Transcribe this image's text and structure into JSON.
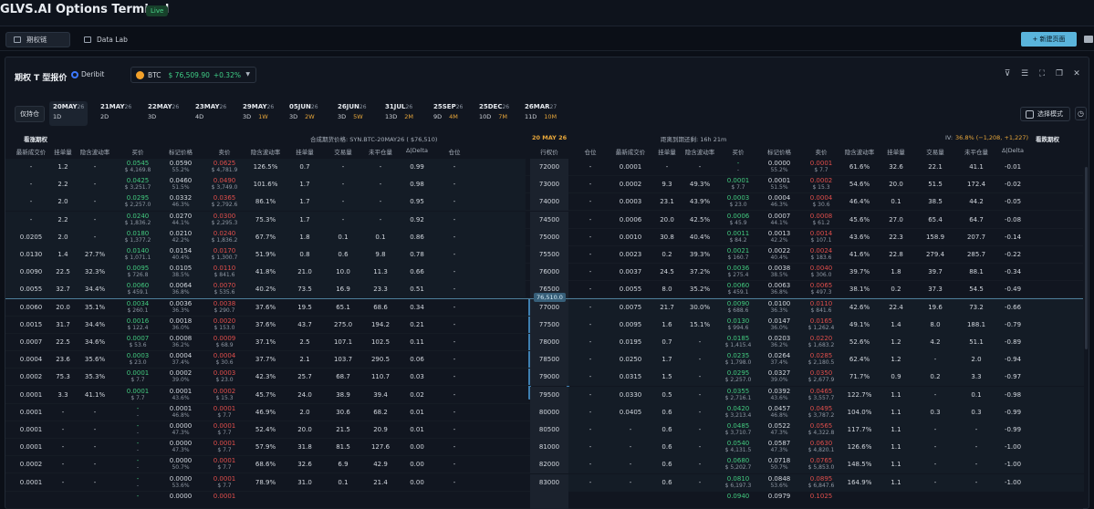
{
  "app": {
    "title": "GLVS.AI Options Terminal",
    "live": "Live"
  },
  "tabs": [
    {
      "label": "期权链"
    },
    {
      "label": "Data Lab"
    }
  ],
  "new_page": "+ 新建页面",
  "panel": {
    "title": "期权 T 型报价",
    "exchange": "Deribit",
    "asset": "BTC",
    "price": "$ 76,509.90",
    "change": "+0.32%"
  },
  "only_btn": "仅持仓",
  "expiries": [
    {
      "date": "20MAY",
      "yy": "26",
      "dte": "1D",
      "cal": ""
    },
    {
      "date": "21MAY",
      "yy": "26",
      "dte": "2D",
      "cal": ""
    },
    {
      "date": "22MAY",
      "yy": "26",
      "dte": "3D",
      "cal": ""
    },
    {
      "date": "23MAY",
      "yy": "26",
      "dte": "4D",
      "cal": ""
    },
    {
      "date": "29MAY",
      "yy": "26",
      "dte": "3D",
      "cal": "1W"
    },
    {
      "date": "05JUN",
      "yy": "26",
      "dte": "3D",
      "cal": "2W"
    },
    {
      "date": "26JUN",
      "yy": "26",
      "dte": "3D",
      "cal": "5W"
    },
    {
      "date": "31JUL",
      "yy": "26",
      "dte": "13D",
      "cal": "2M"
    },
    {
      "date": "25SEP",
      "yy": "26",
      "dte": "9D",
      "cal": "4M"
    },
    {
      "date": "25DEC",
      "yy": "26",
      "dte": "10D",
      "cal": "7M"
    },
    {
      "date": "26MAR",
      "yy": "27",
      "dte": "11D",
      "cal": "10M"
    }
  ],
  "mode_btn": "选择模式",
  "subhead": {
    "calls": "看涨期权",
    "synthetic": "合成期货价格: SYN.BTC-20MAY26 ( $76,510)",
    "expiry": "20 MAY 26",
    "countdown": "距离到期还剩: 16h 21m",
    "iv_label": "IV:",
    "iv": "36.8% (−1,208, +1,227)",
    "puts": "看跌期权"
  },
  "headers": {
    "call": [
      "最新成交价",
      "挂单量",
      "隐含波动率",
      "买价",
      "标记价格",
      "卖价",
      "隐含波动率",
      "挂单量",
      "交易量",
      "未平仓量",
      "Δ|Delta",
      "仓位"
    ],
    "strike": "行权价",
    "put": [
      "仓位",
      "最新成交价",
      "挂单量",
      "隐含波动率",
      "买价",
      "标记价格",
      "卖价",
      "隐含波动率",
      "挂单量",
      "交易量",
      "未平仓量",
      "Δ|Delta"
    ]
  },
  "atm": "76,510.0",
  "rows": [
    {
      "strike": "72000",
      "c": [
        "-",
        "1.2",
        "-",
        [
          "0.0545",
          "$ 4,169.8"
        ],
        [
          "0.0590",
          "55.2%"
        ],
        [
          "0.0625",
          "$ 4,781.9"
        ],
        "126.5%",
        "0.7",
        "-",
        "-",
        "0.99",
        "-"
      ],
      "p": [
        "-",
        "0.0001",
        "-",
        "-",
        [
          "-",
          "-"
        ],
        [
          "0.0000",
          "55.2%"
        ],
        [
          "0.0001",
          "$ 7.7"
        ],
        "61.6%",
        "32.6",
        "22.1",
        "41.1",
        "-0.01"
      ]
    },
    {
      "strike": "73000",
      "c": [
        "-",
        "2.2",
        "-",
        [
          "0.0425",
          "$ 3,251.7"
        ],
        [
          "0.0460",
          "51.5%"
        ],
        [
          "0.0490",
          "$ 3,749.0"
        ],
        "101.6%",
        "1.7",
        "-",
        "-",
        "0.98",
        "-"
      ],
      "p": [
        "-",
        "0.0002",
        "9.3",
        "49.3%",
        [
          "0.0001",
          "$ 7.7"
        ],
        [
          "0.0001",
          "51.5%"
        ],
        [
          "0.0002",
          "$ 15.3"
        ],
        "54.6%",
        "20.0",
        "51.5",
        "172.4",
        "-0.02"
      ]
    },
    {
      "strike": "74000",
      "c": [
        "-",
        "2.0",
        "-",
        [
          "0.0295",
          "$ 2,257.0"
        ],
        [
          "0.0332",
          "46.3%"
        ],
        [
          "0.0365",
          "$ 2,792.6"
        ],
        "86.1%",
        "1.7",
        "-",
        "-",
        "0.95",
        "-"
      ],
      "p": [
        "-",
        "0.0003",
        "23.1",
        "43.9%",
        [
          "0.0003",
          "$ 23.0"
        ],
        [
          "0.0004",
          "46.3%"
        ],
        [
          "0.0004",
          "$ 30.6"
        ],
        "46.4%",
        "0.1",
        "38.5",
        "44.2",
        "-0.05"
      ]
    },
    {
      "strike": "74500",
      "c": [
        "-",
        "2.2",
        "-",
        [
          "0.0240",
          "$ 1,836.2"
        ],
        [
          "0.0270",
          "44.1%"
        ],
        [
          "0.0300",
          "$ 2,295.3"
        ],
        "75.3%",
        "1.7",
        "-",
        "-",
        "0.92",
        "-"
      ],
      "p": [
        "-",
        "0.0006",
        "20.0",
        "42.5%",
        [
          "0.0006",
          "$ 45.9"
        ],
        [
          "0.0007",
          "44.1%"
        ],
        [
          "0.0008",
          "$ 61.2"
        ],
        "45.6%",
        "27.0",
        "65.4",
        "64.7",
        "-0.08"
      ]
    },
    {
      "strike": "75000",
      "c": [
        "0.0205",
        "2.0",
        "-",
        [
          "0.0180",
          "$ 1,377.2"
        ],
        [
          "0.0210",
          "42.2%"
        ],
        [
          "0.0240",
          "$ 1,836.2"
        ],
        "67.7%",
        "1.8",
        "0.1",
        "0.1",
        "0.86",
        "-"
      ],
      "p": [
        "-",
        "0.0010",
        "30.8",
        "40.4%",
        [
          "0.0011",
          "$ 84.2"
        ],
        [
          "0.0013",
          "42.2%"
        ],
        [
          "0.0014",
          "$ 107.1"
        ],
        "43.6%",
        "22.3",
        "158.9",
        "207.7",
        "-0.14"
      ]
    },
    {
      "strike": "75500",
      "c": [
        "0.0130",
        "1.4",
        "27.7%",
        [
          "0.0140",
          "$ 1,071.1"
        ],
        [
          "0.0154",
          "40.4%"
        ],
        [
          "0.0170",
          "$ 1,300.7"
        ],
        "51.9%",
        "0.8",
        "0.6",
        "9.8",
        "0.78",
        "-"
      ],
      "p": [
        "-",
        "0.0023",
        "0.2",
        "39.3%",
        [
          "0.0021",
          "$ 160.7"
        ],
        [
          "0.0022",
          "40.4%"
        ],
        [
          "0.0024",
          "$ 183.6"
        ],
        "41.6%",
        "22.8",
        "279.4",
        "285.7",
        "-0.22"
      ]
    },
    {
      "strike": "76000",
      "c": [
        "0.0090",
        "22.5",
        "32.3%",
        [
          "0.0095",
          "$ 726.8"
        ],
        [
          "0.0105",
          "38.5%"
        ],
        [
          "0.0110",
          "$ 841.6"
        ],
        "41.8%",
        "21.0",
        "10.0",
        "11.3",
        "0.66",
        "-"
      ],
      "p": [
        "-",
        "0.0037",
        "24.5",
        "37.2%",
        [
          "0.0036",
          "$ 275.4"
        ],
        [
          "0.0038",
          "38.5%"
        ],
        [
          "0.0040",
          "$ 306.0"
        ],
        "39.7%",
        "1.8",
        "39.7",
        "88.1",
        "-0.34"
      ]
    },
    {
      "strike": "76500",
      "c": [
        "0.0055",
        "32.7",
        "34.4%",
        [
          "0.0060",
          "$ 459.1"
        ],
        [
          "0.0064",
          "36.8%"
        ],
        [
          "0.0070",
          "$ 535.6"
        ],
        "40.2%",
        "73.5",
        "16.9",
        "23.3",
        "0.51",
        "-"
      ],
      "p": [
        "-",
        "0.0055",
        "8.0",
        "35.2%",
        [
          "0.0060",
          "$ 459.1"
        ],
        [
          "0.0063",
          "36.8%"
        ],
        [
          "0.0065",
          "$ 497.3"
        ],
        "38.1%",
        "0.2",
        "37.3",
        "54.5",
        "-0.49"
      ]
    },
    {
      "strike": "77000",
      "c": [
        "0.0060",
        "20.0",
        "35.1%",
        [
          "0.0034",
          "$ 260.1"
        ],
        [
          "0.0036",
          "36.3%"
        ],
        [
          "0.0038",
          "$ 290.7"
        ],
        "37.6%",
        "19.5",
        "65.1",
        "68.6",
        "0.34",
        "-"
      ],
      "p": [
        "-",
        "0.0075",
        "21.7",
        "30.0%",
        [
          "0.0090",
          "$ 688.6"
        ],
        [
          "0.0100",
          "36.3%"
        ],
        [
          "0.0110",
          "$ 841.6"
        ],
        "42.6%",
        "22.4",
        "19.6",
        "73.2",
        "-0.66"
      ]
    },
    {
      "strike": "77500",
      "c": [
        "0.0015",
        "31.7",
        "34.4%",
        [
          "0.0016",
          "$ 122.4"
        ],
        [
          "0.0018",
          "36.0%"
        ],
        [
          "0.0020",
          "$ 153.0"
        ],
        "37.6%",
        "43.7",
        "275.0",
        "194.2",
        "0.21",
        "-"
      ],
      "p": [
        "-",
        "0.0095",
        "1.6",
        "15.1%",
        [
          "0.0130",
          "$ 994.6"
        ],
        [
          "0.0147",
          "36.0%"
        ],
        [
          "0.0165",
          "$ 1,262.4"
        ],
        "49.1%",
        "1.4",
        "8.0",
        "188.1",
        "-0.79"
      ]
    },
    {
      "strike": "78000",
      "c": [
        "0.0007",
        "22.5",
        "34.6%",
        [
          "0.0007",
          "$ 53.6"
        ],
        [
          "0.0008",
          "36.2%"
        ],
        [
          "0.0009",
          "$ 68.9"
        ],
        "37.1%",
        "2.5",
        "107.1",
        "102.5",
        "0.11",
        "-"
      ],
      "p": [
        "-",
        "0.0195",
        "0.7",
        "-",
        [
          "0.0185",
          "$ 1,415.4"
        ],
        [
          "0.0203",
          "36.2%"
        ],
        [
          "0.0220",
          "$ 1,683.2"
        ],
        "52.6%",
        "1.2",
        "4.2",
        "51.1",
        "-0.89"
      ]
    },
    {
      "strike": "78500",
      "c": [
        "0.0004",
        "23.6",
        "35.6%",
        [
          "0.0003",
          "$ 23.0"
        ],
        [
          "0.0004",
          "37.4%"
        ],
        [
          "0.0004",
          "$ 30.6"
        ],
        "37.7%",
        "2.1",
        "103.7",
        "290.5",
        "0.06",
        "-"
      ],
      "p": [
        "-",
        "0.0250",
        "1.7",
        "-",
        [
          "0.0235",
          "$ 1,798.0"
        ],
        [
          "0.0264",
          "37.4%"
        ],
        [
          "0.0285",
          "$ 2,180.5"
        ],
        "62.4%",
        "1.2",
        "-",
        "2.0",
        "-0.94"
      ]
    },
    {
      "strike": "79000",
      "c": [
        "0.0002",
        "75.3",
        "35.3%",
        [
          "0.0001",
          "$ 7.7"
        ],
        [
          "0.0002",
          "39.0%"
        ],
        [
          "0.0003",
          "$ 23.0"
        ],
        "42.3%",
        "25.7",
        "68.7",
        "110.7",
        "0.03",
        "-"
      ],
      "p": [
        "-",
        "0.0315",
        "1.5",
        "-",
        [
          "0.0295",
          "$ 2,257.0"
        ],
        [
          "0.0327",
          "39.0%"
        ],
        [
          "0.0350",
          "$ 2,677.9"
        ],
        "71.7%",
        "0.9",
        "0.2",
        "3.3",
        "-0.97"
      ]
    },
    {
      "strike": "79500",
      "c": [
        "0.0001",
        "3.3",
        "41.1%",
        [
          "0.0001",
          "$ 7.7"
        ],
        [
          "0.0001",
          "43.6%"
        ],
        [
          "0.0002",
          "$ 15.3"
        ],
        "45.7%",
        "24.0",
        "38.9",
        "39.4",
        "0.02",
        "-"
      ],
      "p": [
        "-",
        "0.0330",
        "0.5",
        "-",
        [
          "0.0355",
          "$ 2,716.1"
        ],
        [
          "0.0392",
          "43.6%"
        ],
        [
          "0.0465",
          "$ 3,557.7"
        ],
        "122.7%",
        "1.1",
        "-",
        "0.1",
        "-0.98"
      ]
    },
    {
      "strike": "80000",
      "c": [
        "0.0001",
        "-",
        "-",
        [
          "-",
          "-"
        ],
        [
          "0.0001",
          "46.8%"
        ],
        [
          "0.0001",
          "$ 7.7"
        ],
        "46.9%",
        "2.0",
        "30.6",
        "68.2",
        "0.01",
        "-"
      ],
      "p": [
        "-",
        "0.0405",
        "0.6",
        "-",
        [
          "0.0420",
          "$ 3,213.4"
        ],
        [
          "0.0457",
          "46.8%"
        ],
        [
          "0.0495",
          "$ 3,787.2"
        ],
        "104.0%",
        "1.1",
        "0.3",
        "0.3",
        "-0.99"
      ]
    },
    {
      "strike": "80500",
      "c": [
        "0.0001",
        "-",
        "-",
        [
          "-",
          "-"
        ],
        [
          "0.0000",
          "47.3%"
        ],
        [
          "0.0001",
          "$ 7.7"
        ],
        "52.4%",
        "20.0",
        "21.5",
        "20.9",
        "0.01",
        "-"
      ],
      "p": [
        "-",
        "-",
        "0.6",
        "-",
        [
          "0.0485",
          "$ 3,710.7"
        ],
        [
          "0.0522",
          "47.3%"
        ],
        [
          "0.0565",
          "$ 4,322.8"
        ],
        "117.7%",
        "1.1",
        "-",
        "-",
        "-0.99"
      ]
    },
    {
      "strike": "81000",
      "c": [
        "0.0001",
        "-",
        "-",
        [
          "-",
          "-"
        ],
        [
          "0.0000",
          "47.3%"
        ],
        [
          "0.0001",
          "$ 7.7"
        ],
        "57.9%",
        "31.8",
        "81.5",
        "127.6",
        "0.00",
        "-"
      ],
      "p": [
        "-",
        "-",
        "0.6",
        "-",
        [
          "0.0540",
          "$ 4,131.5"
        ],
        [
          "0.0587",
          "47.3%"
        ],
        [
          "0.0630",
          "$ 4,820.1"
        ],
        "126.6%",
        "1.1",
        "-",
        "-",
        "-1.00"
      ]
    },
    {
      "strike": "82000",
      "c": [
        "0.0002",
        "-",
        "-",
        [
          "-",
          "-"
        ],
        [
          "0.0000",
          "50.7%"
        ],
        [
          "0.0001",
          "$ 7.7"
        ],
        "68.6%",
        "32.6",
        "6.9",
        "42.9",
        "0.00",
        "-"
      ],
      "p": [
        "-",
        "-",
        "0.6",
        "-",
        [
          "0.0680",
          "$ 5,202.7"
        ],
        [
          "0.0718",
          "50.7%"
        ],
        [
          "0.0765",
          "$ 5,853.0"
        ],
        "148.5%",
        "1.1",
        "-",
        "-",
        "-1.00"
      ]
    },
    {
      "strike": "83000",
      "c": [
        "0.0001",
        "-",
        "-",
        [
          "-",
          "-"
        ],
        [
          "0.0000",
          "53.6%"
        ],
        [
          "0.0001",
          "$ 7.7"
        ],
        "78.9%",
        "31.0",
        "0.1",
        "21.4",
        "0.00",
        "-"
      ],
      "p": [
        "-",
        "-",
        "0.6",
        "-",
        [
          "0.0810",
          "$ 6,197.3"
        ],
        [
          "0.0848",
          "53.6%"
        ],
        [
          "0.0895",
          "$ 6,847.6"
        ],
        "164.9%",
        "1.1",
        "-",
        "-",
        "-1.00"
      ]
    },
    {
      "strike": "",
      "c": [
        "",
        "",
        "",
        [
          "-",
          ""
        ],
        [
          "0.0000",
          ""
        ],
        [
          "0.0001",
          ""
        ],
        "",
        "",
        "",
        "",
        "",
        ""
      ],
      "p": [
        "",
        "",
        "",
        "",
        [
          "0.0940",
          ""
        ],
        [
          "0.0979",
          ""
        ],
        [
          "0.1025",
          ""
        ],
        "",
        "",
        "",
        "",
        ""
      ]
    }
  ]
}
